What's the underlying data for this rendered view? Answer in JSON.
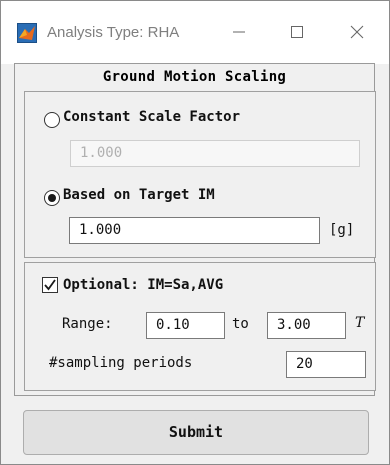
{
  "window": {
    "title": "Analysis Type: RHA",
    "minimize_icon": "minimize-icon",
    "maximize_icon": "maximize-icon",
    "close_icon": "close-icon"
  },
  "panel": {
    "title": "Ground Motion Scaling"
  },
  "scaling": {
    "constant": {
      "label": "Constant Scale Factor",
      "selected": false,
      "value": "1.000"
    },
    "target_im": {
      "label": "Based on Target IM",
      "selected": true,
      "value": "1.000",
      "unit": "[g]"
    }
  },
  "optional": {
    "checked": true,
    "label": "Optional: IM=Sa,AVG",
    "range_label": "Range:",
    "range_from": "0.10",
    "to_label": "to",
    "range_to": "3.00",
    "period_symbol": "T",
    "sampling_label": "#sampling periods",
    "sampling_value": "20"
  },
  "actions": {
    "submit_label": "Submit"
  },
  "colors": {
    "window_bg": "#f0f0f0",
    "titlebar_bg": "#ffffff",
    "button_bg": "#e1e1e1",
    "check_color": "#1a1a1a",
    "app_icon_orange": "#d35400",
    "app_icon_blue": "#2a6db5"
  }
}
